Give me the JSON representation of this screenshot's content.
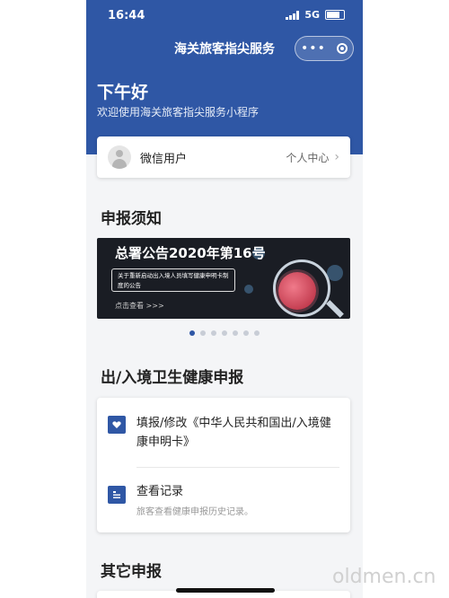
{
  "status_bar": {
    "time": "16:44",
    "network": "5G"
  },
  "nav": {
    "title": "海关旅客指尖服务"
  },
  "header": {
    "greeting": "下午好",
    "welcome": "欢迎使用海关旅客指尖服务小程序"
  },
  "user_card": {
    "name": "微信用户",
    "center_label": "个人中心"
  },
  "notice_section": {
    "title": "申报须知"
  },
  "banner": {
    "title": "总署公告2020年第16号",
    "box_text": "关于重新启动出入境人员填写健康申明卡制度的公告",
    "link": "点击查看 >>>",
    "slide_count": 7,
    "active_index": 0
  },
  "health_section": {
    "title": "出/入境卫生健康申报",
    "items": [
      {
        "label": "填报/修改《中华人民共和国出/入境健康申明卡》",
        "icon": "heart-icon"
      },
      {
        "label": "查看记录",
        "sub": "旅客查看健康申报历史记录。",
        "icon": "record-icon"
      }
    ]
  },
  "other_section": {
    "title": "其它申报"
  },
  "watermark": "oldmen.cn",
  "colors": {
    "brand": "#2f57a5",
    "background": "#f4f5f7"
  }
}
